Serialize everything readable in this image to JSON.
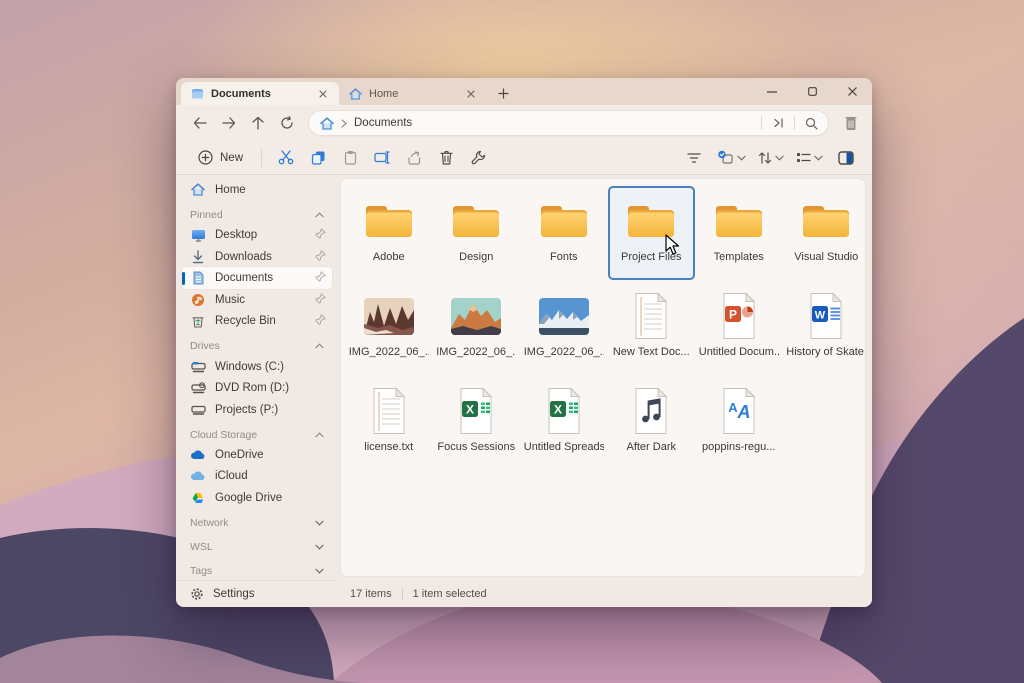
{
  "tabs": {
    "tab1": {
      "label": "Documents",
      "active": true
    },
    "tab2": {
      "label": "Home",
      "active": false
    }
  },
  "address": {
    "path": "Documents"
  },
  "toolbar": {
    "new_label": "New"
  },
  "sidebar": {
    "home_label": "Home",
    "pinned_header": "Pinned",
    "pinned": [
      {
        "label": "Desktop"
      },
      {
        "label": "Downloads"
      },
      {
        "label": "Documents",
        "selected": true
      },
      {
        "label": "Music"
      },
      {
        "label": "Recycle Bin"
      }
    ],
    "drives_header": "Drives",
    "drives": [
      {
        "label": "Windows (C:)"
      },
      {
        "label": "DVD Rom (D:)"
      },
      {
        "label": "Projects (P:)"
      }
    ],
    "cloud_header": "Cloud Storage",
    "cloud": [
      {
        "label": "OneDrive"
      },
      {
        "label": "iCloud"
      },
      {
        "label": "Google Drive"
      }
    ],
    "network_header": "Network",
    "wsl_header": "WSL",
    "tags_header": "Tags",
    "settings_label": "Settings"
  },
  "grid": {
    "items": [
      {
        "label": "Adobe",
        "type": "folder"
      },
      {
        "label": "Design",
        "type": "folder"
      },
      {
        "label": "Fonts",
        "type": "folder"
      },
      {
        "label": "Project Files",
        "type": "folder",
        "selected": true
      },
      {
        "label": "Templates",
        "type": "folder"
      },
      {
        "label": "Visual Studio",
        "type": "folder"
      },
      {
        "label": "IMG_2022_06_...",
        "type": "image"
      },
      {
        "label": "IMG_2022_06_...",
        "type": "image"
      },
      {
        "label": "IMG_2022_06_...",
        "type": "image"
      },
      {
        "label": "New Text Doc...",
        "type": "text"
      },
      {
        "label": "Untitled Docum...",
        "type": "powerpoint"
      },
      {
        "label": "History of Skate...",
        "type": "word"
      },
      {
        "label": "license.txt",
        "type": "text"
      },
      {
        "label": "Focus Sessions",
        "type": "excel"
      },
      {
        "label": "Untitled Spreads...",
        "type": "excel"
      },
      {
        "label": "After Dark",
        "type": "audio"
      },
      {
        "label": "poppins-regu...",
        "type": "font"
      }
    ]
  },
  "statusbar": {
    "items_count": "17 items",
    "selection": "1 item selected"
  },
  "colors": {
    "accent": "#0067c0",
    "folder_yellow": "#f7bb45",
    "chrome": "#f3ece6",
    "card": "#faf6f3",
    "selection_border": "#4a7fc1"
  }
}
